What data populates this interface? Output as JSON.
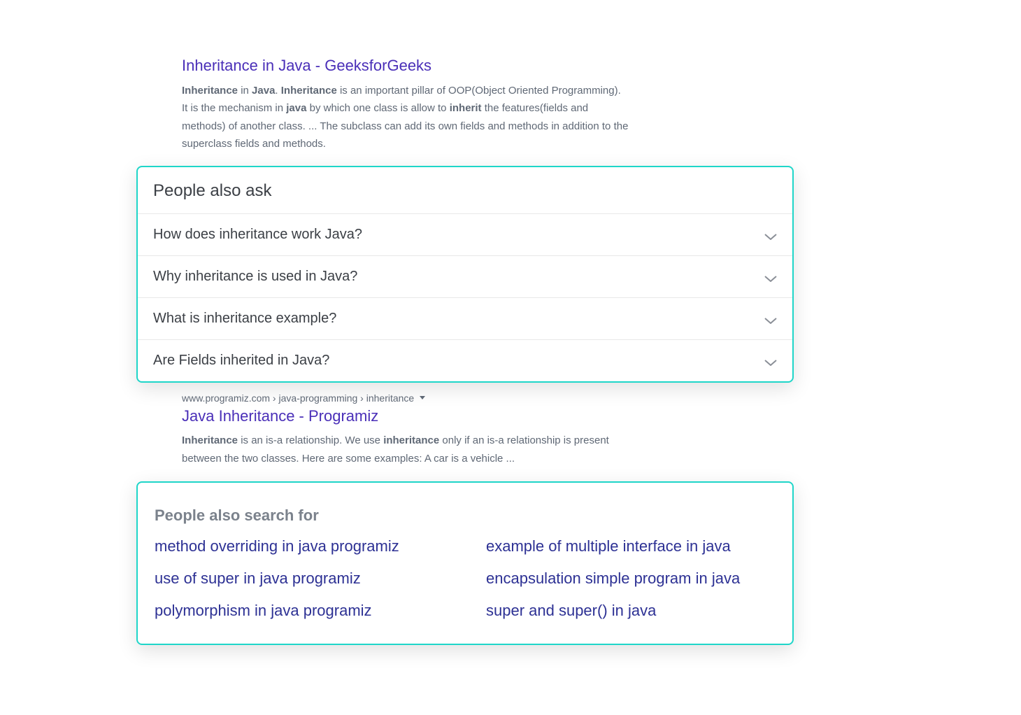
{
  "result1": {
    "title": "Inheritance in Java - GeeksforGeeks",
    "snippet_bold1": "Inheritance",
    "snippet_t1": " in ",
    "snippet_bold2": "Java",
    "snippet_t2": ". ",
    "snippet_bold3": "Inheritance",
    "snippet_t3": " is an important pillar of OOP(Object Oriented Programming). It is the mechanism in ",
    "snippet_bold4": "java",
    "snippet_t4": " by which one class is allow to ",
    "snippet_bold5": "inherit",
    "snippet_t5": " the features(fields and methods) of another class. ... The subclass can add its own fields and methods in addition to the superclass fields and methods."
  },
  "paa": {
    "heading": "People also ask",
    "items": [
      "How does inheritance work Java?",
      "Why inheritance is used in Java?",
      "What is inheritance example?",
      "Are Fields inherited in Java?"
    ]
  },
  "result2": {
    "url": "www.programiz.com › java-programming › inheritance",
    "title": "Java Inheritance - Programiz",
    "snippet_bold1": "Inheritance",
    "snippet_t1": " is an is-a relationship. We use ",
    "snippet_bold2": "inheritance",
    "snippet_t2": " only if an is-a relationship is present between the two classes. Here are some examples: A car is a vehicle ..."
  },
  "pasf": {
    "heading": "People also search for",
    "col1": [
      "method overriding in java programiz",
      "use of super in java programiz",
      "polymorphism in java programiz"
    ],
    "col2": [
      "example of multiple interface in java",
      "encapsulation simple program in java",
      "super and super() in java"
    ]
  }
}
